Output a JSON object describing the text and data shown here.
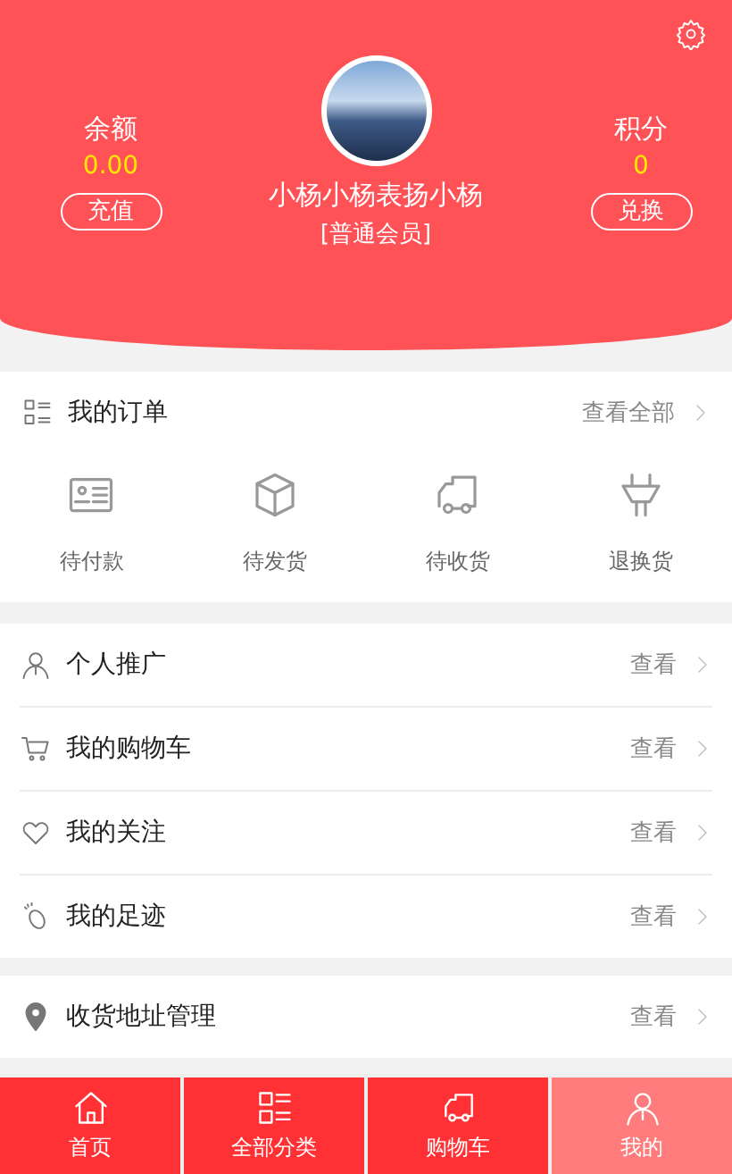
{
  "header": {
    "balance": {
      "label": "余额",
      "value": "0.00",
      "action": "充值"
    },
    "user": {
      "name": "小杨小杨表扬小杨",
      "level": "[普通会员]"
    },
    "points": {
      "label": "积分",
      "value": "0",
      "action": "兑换"
    }
  },
  "orders": {
    "title": "我的订单",
    "link": "查看全部",
    "items": [
      {
        "kind": "card",
        "label": "待付款"
      },
      {
        "kind": "box",
        "label": "待发货"
      },
      {
        "kind": "truck",
        "label": "待收货"
      },
      {
        "kind": "plug",
        "label": "退换货"
      }
    ]
  },
  "menu_groups": [
    [
      {
        "kind": "person",
        "label": "个人推广",
        "link": "查看"
      },
      {
        "kind": "cart",
        "label": "我的购物车",
        "link": "查看"
      },
      {
        "kind": "heart",
        "label": "我的关注",
        "link": "查看"
      },
      {
        "kind": "footprint",
        "label": "我的足迹",
        "link": "查看"
      }
    ],
    [
      {
        "kind": "pin",
        "label": "收货地址管理",
        "link": "查看"
      }
    ]
  ],
  "tabs": [
    {
      "kind": "home",
      "label": "首页",
      "selected": false
    },
    {
      "kind": "grid",
      "label": "全部分类",
      "selected": false
    },
    {
      "kind": "truck",
      "label": "购物车",
      "selected": false
    },
    {
      "kind": "person",
      "label": "我的",
      "selected": true
    }
  ]
}
